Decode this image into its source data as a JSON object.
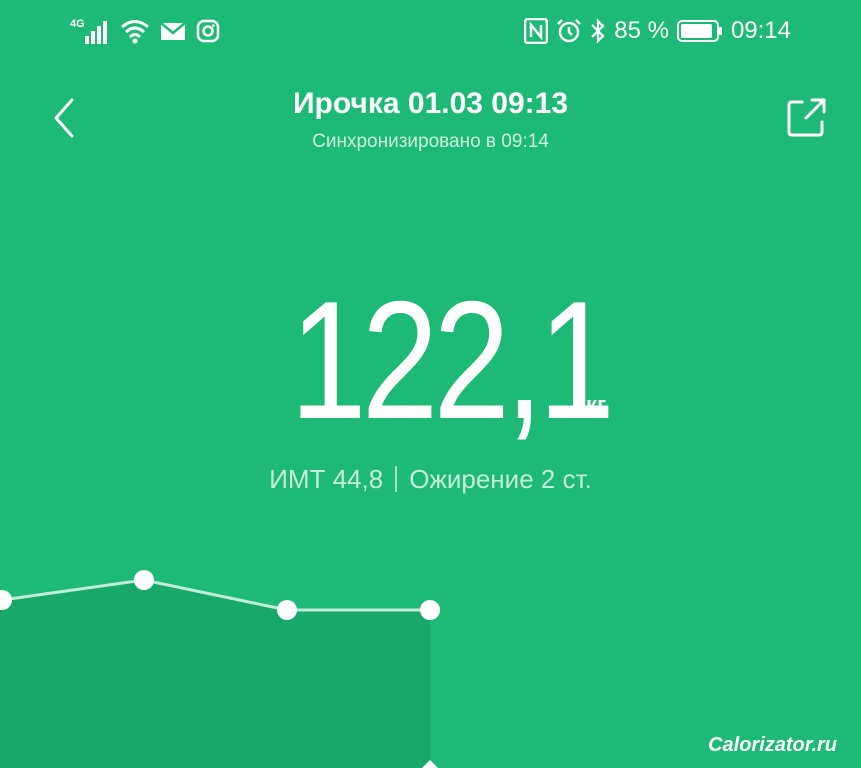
{
  "status_bar": {
    "network": "4G",
    "battery_percent": "85 %",
    "time": "09:14",
    "left_icons": [
      "signal-icon",
      "wifi-icon",
      "mail-icon",
      "instagram-icon"
    ],
    "right_icons": [
      "nfc-icon",
      "alarm-icon",
      "bluetooth-icon",
      "battery-icon"
    ]
  },
  "header": {
    "title": "Ирочка 01.03 09:13",
    "subtitle": "Синхронизировано в 09:14",
    "back_icon": "chevron-left-icon",
    "share_icon": "share-icon"
  },
  "measurement": {
    "weight": "122,1",
    "unit": "кг",
    "bmi": "ИМТ 44,8",
    "category": "Ожирение 2 ст."
  },
  "chart_data": {
    "type": "line",
    "x": [
      1,
      2,
      3,
      4
    ],
    "series": [
      {
        "values": [
          122.2,
          122.4,
          122.1,
          122.1
        ]
      }
    ],
    "ylim": [
      121.0,
      123.0
    ],
    "selected_index": 3,
    "grid": false
  },
  "watermark": "Calorizator.ru",
  "colors": {
    "background": "#1dba76",
    "line": "#bfeed8",
    "area": "#18a968",
    "dot": "#ffffff"
  }
}
